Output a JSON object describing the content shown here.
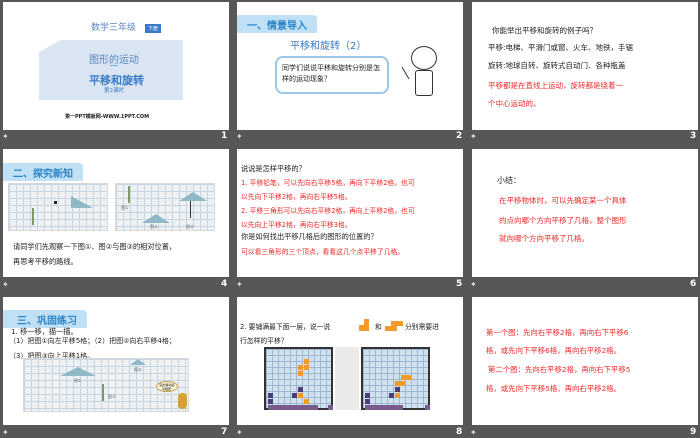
{
  "slides": [
    {
      "number": "1",
      "grade": "数学三年级",
      "badge": "下册",
      "unit": "图形的运动",
      "dash": "—",
      "title": "平移和旋转",
      "lesson": "第2课时",
      "footer": "第一PPT模板网-WWW.1PPT.COM"
    },
    {
      "number": "2",
      "section": "一、情景导入",
      "title": "平移和旋转（2）",
      "bubble": "同学们说说平移和旋转分别是怎样的运动现象？"
    },
    {
      "number": "3",
      "question": "你能举出平移和旋转的例子吗？",
      "line1": "平移:电梯、平滑门或窗、火车、地铁，手锯",
      "line2": "旋转:地球自转、旋转式自动门、各种瓶盖",
      "answer1": "平移都是在直线上运动，旋转都是绕着一",
      "answer2": "个中心运动的。"
    },
    {
      "number": "4",
      "section": "二、探究新知",
      "fig1": "图①",
      "fig2": "图②",
      "fig3": "图③",
      "text1": "请同学们先观察一下图①、图②与图③的相对位置，",
      "text2": "再思考平移的路线。"
    },
    {
      "number": "5",
      "q1": "说说是怎样平移的？",
      "a1a": "1. 平移铅笔，可以先向右平移5格，再向下平移2格，也可",
      "a1b": "以先向下平移2格，再向右平移5格。",
      "a2a": "2. 平移三角形可以先向右平移2格，再向上平移2格，也可",
      "a2b": "以先向上平移2格，再向右平移3格。",
      "q2": "你是如何找出平移几格后的图形的位置的？",
      "a3": "可以看三角形的三个顶点，看看这几个点平移了几格。"
    },
    {
      "number": "6",
      "heading": "小结：",
      "s1": "在平移物体时，可以先确定某一个具体",
      "s2": "的点向哪个方向平移了几格，整个图形",
      "s3": "就向哪个方向平移了几格。"
    },
    {
      "number": "7",
      "section": "三、巩固练习",
      "l1": "1. 移一移，描一描。",
      "l2": "（1）把图①向左平移5格；（2）把图②向右平移4格；",
      "l3": "（3）把图③向上平移1格。",
      "fig1": "图①",
      "fig2": "图②",
      "fig3": "图③",
      "speech": "画出移动后的图形"
    },
    {
      "number": "8",
      "l1a": "2. 要铺满最下面一层，说一说",
      "l1b": "和",
      "l1c": "分别需要进",
      "l2": "行怎样的平移？"
    },
    {
      "number": "9",
      "p1a": "第一个图：先向右平移2格，再向右下平移6",
      "p1b": "格，或先向下平移6格，再向右平移2格。",
      "p2a": "第二个图：先向右平移2格，再向右下平移5",
      "p2b": "格，或先向下平移5格，再向右平移2格。"
    }
  ],
  "transition_icon": "animation-icon",
  "colors": {
    "background": "#575757",
    "accent": "#3a7bc8",
    "red": "#ee2a2a"
  }
}
